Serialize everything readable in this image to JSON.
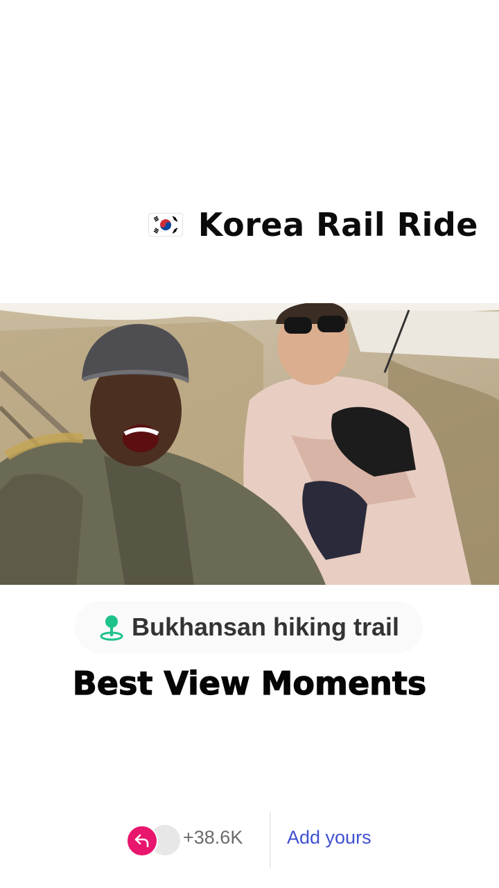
{
  "header": {
    "flag_icon": "south-korea-flag-icon",
    "title": "Korea Rail Ride"
  },
  "photo": {
    "icon": "selfie-photo"
  },
  "location": {
    "icon": "location-pin-icon",
    "label": "Bukhansan hiking trail",
    "pin_color": "#1ec28a"
  },
  "subtitle": "Best View Moments",
  "footer": {
    "avatar_icon": "reply-arrow-icon",
    "avatar_color": "#e8166d",
    "count": "+38.6K",
    "add_yours": "Add yours",
    "accent_color": "#3f4fd0"
  }
}
